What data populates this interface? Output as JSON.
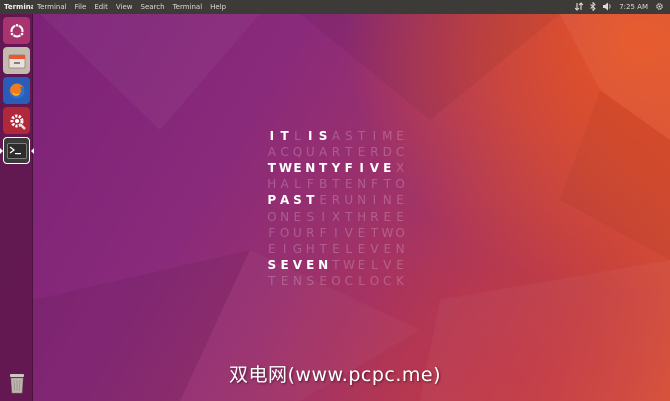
{
  "panel": {
    "app_name": "Terminal",
    "menus": [
      "Terminal",
      "File",
      "Edit",
      "View",
      "Search",
      "Terminal",
      "Help"
    ],
    "time": "7:25 AM",
    "indicators": [
      "transfer-icon",
      "bluetooth-icon",
      "volume-icon",
      "gear-icon"
    ]
  },
  "launcher": {
    "items": [
      {
        "name": "ubuntu-dash-icon",
        "active": false
      },
      {
        "name": "files-icon",
        "active": false
      },
      {
        "name": "firefox-icon",
        "active": false
      },
      {
        "name": "system-settings-icon",
        "active": false
      },
      {
        "name": "terminal-icon",
        "active": true
      },
      {
        "name": "trash-icon",
        "active": false
      }
    ]
  },
  "word_clock": {
    "rows": [
      {
        "letters": "ITLISASTIME",
        "lit": [
          0,
          1,
          3,
          4
        ]
      },
      {
        "letters": "ACQUARTERDC",
        "lit": []
      },
      {
        "letters": "TWENTYFIVEX",
        "lit": [
          0,
          1,
          2,
          3,
          4,
          5,
          6,
          7,
          8,
          9
        ]
      },
      {
        "letters": "HALFBTENFTO",
        "lit": []
      },
      {
        "letters": "PASTERUNINE",
        "lit": [
          0,
          1,
          2,
          3
        ]
      },
      {
        "letters": "ONESIXTHREE",
        "lit": []
      },
      {
        "letters": "FOURFIVETWO",
        "lit": []
      },
      {
        "letters": "EIGHTELEVEN",
        "lit": []
      },
      {
        "letters": "SEVENTWELVE",
        "lit": [
          0,
          1,
          2,
          3,
          4
        ]
      },
      {
        "letters": "TENSEOCLOCK",
        "lit": []
      }
    ]
  },
  "watermark": "双电网(www.pcpc.me)"
}
